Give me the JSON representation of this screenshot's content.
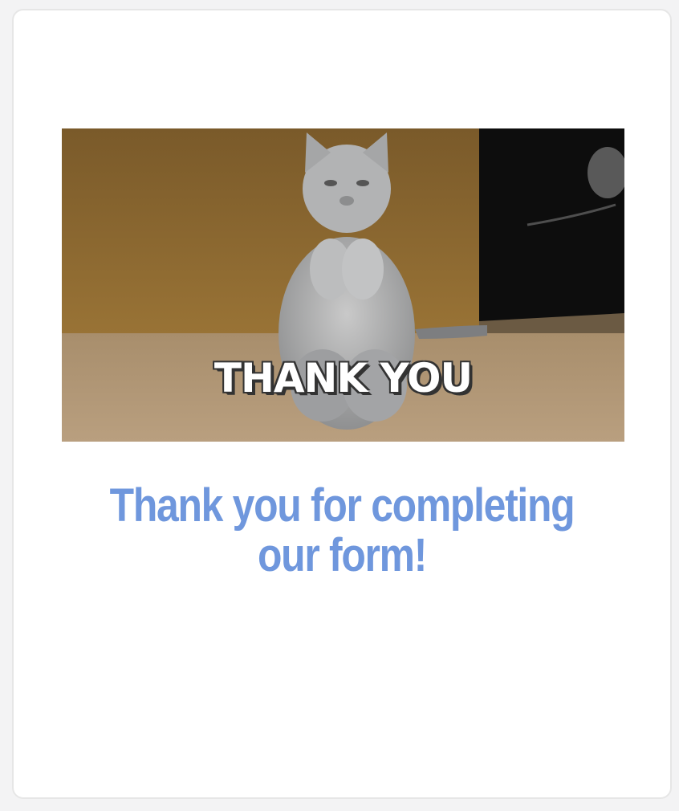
{
  "gif": {
    "caption": "THANK YOU",
    "subject": "cat-image"
  },
  "message": {
    "text": "Thank you for completing our form!",
    "color": "#6f97dd"
  }
}
